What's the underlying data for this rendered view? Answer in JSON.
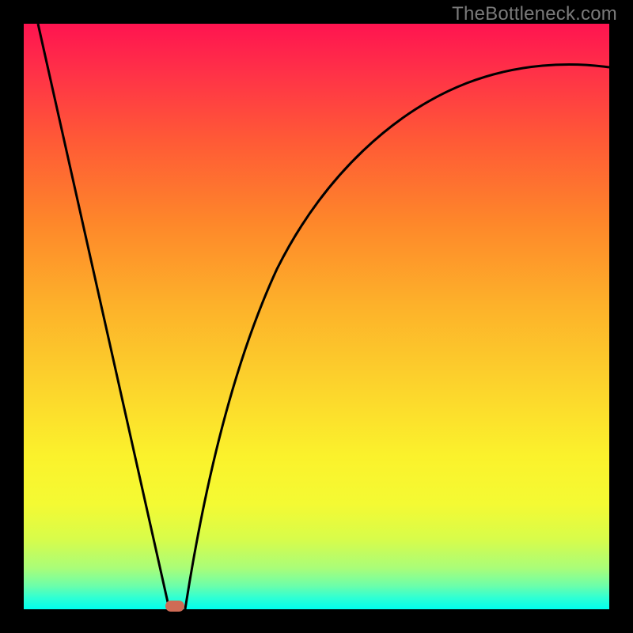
{
  "watermark": "TheBottleneck.com",
  "chart_data": {
    "type": "line",
    "title": "",
    "xlabel": "",
    "ylabel": "",
    "xlim": [
      0,
      1
    ],
    "ylim": [
      0,
      1
    ],
    "background_gradient": {
      "stops": [
        {
          "pos": 0.0,
          "color": "#ff1450"
        },
        {
          "pos": 0.08,
          "color": "#ff3048"
        },
        {
          "pos": 0.2,
          "color": "#ff5a36"
        },
        {
          "pos": 0.34,
          "color": "#fe872a"
        },
        {
          "pos": 0.48,
          "color": "#fdb12a"
        },
        {
          "pos": 0.62,
          "color": "#fcd42c"
        },
        {
          "pos": 0.74,
          "color": "#fbf22c"
        },
        {
          "pos": 0.82,
          "color": "#f4fa33"
        },
        {
          "pos": 0.88,
          "color": "#d8fc4a"
        },
        {
          "pos": 0.93,
          "color": "#a9fd79"
        },
        {
          "pos": 0.96,
          "color": "#6cfeaa"
        },
        {
          "pos": 0.98,
          "color": "#30ffd3"
        },
        {
          "pos": 1.0,
          "color": "#00ffee"
        }
      ]
    },
    "series": [
      {
        "name": "left-linear-descent",
        "x": [
          0.024,
          0.248
        ],
        "y": [
          1.0,
          0.0
        ]
      },
      {
        "name": "right-asymptotic-rise",
        "x": [
          0.275,
          0.3,
          0.33,
          0.37,
          0.42,
          0.48,
          0.55,
          0.63,
          0.72,
          0.82,
          0.91,
          1.0
        ],
        "y": [
          0.0,
          0.12,
          0.24,
          0.37,
          0.49,
          0.6,
          0.7,
          0.78,
          0.84,
          0.88,
          0.905,
          0.925
        ]
      }
    ],
    "marker": {
      "x": 0.258,
      "y": 0.0,
      "shape": "pill",
      "color": "#cf6b55"
    }
  }
}
